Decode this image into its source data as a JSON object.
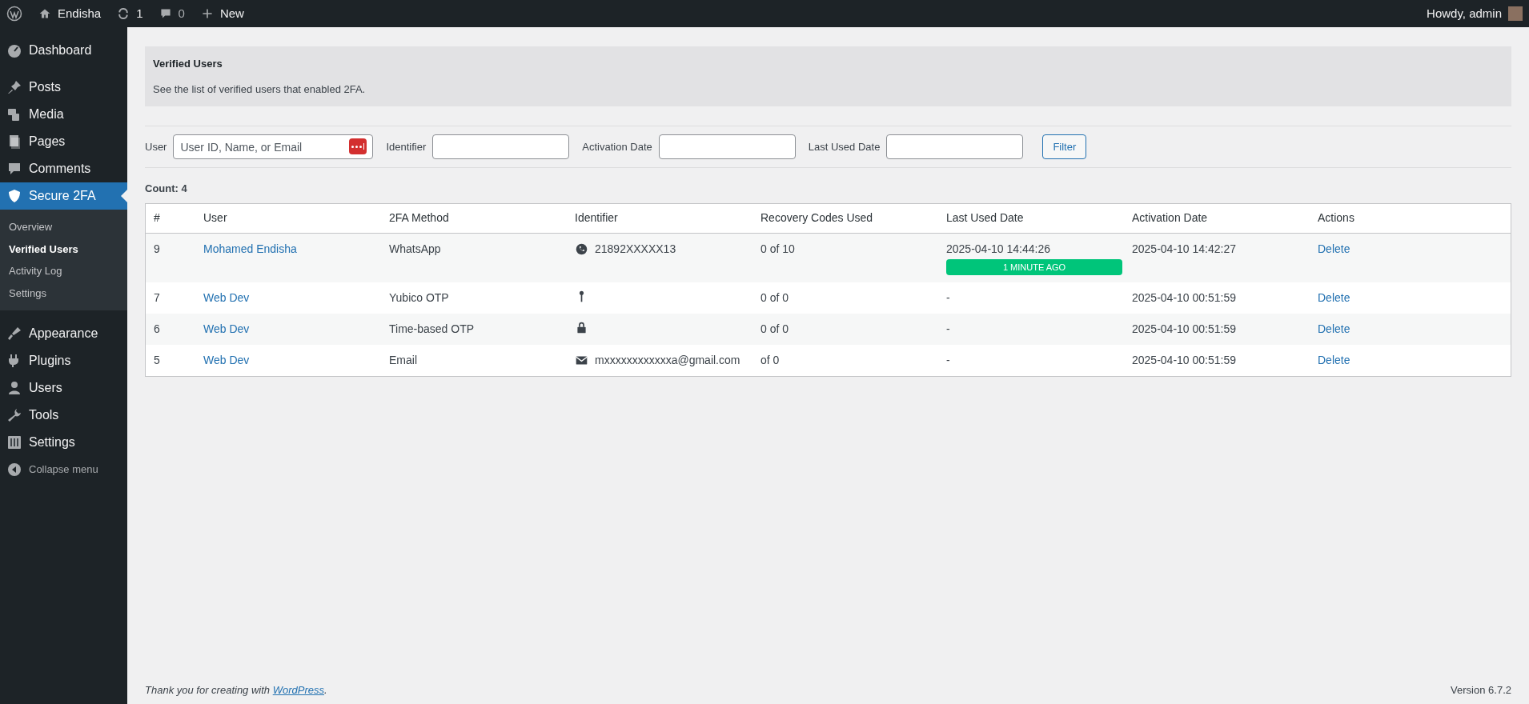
{
  "admin_bar": {
    "site": "Endisha",
    "updates": "1",
    "comments": "0",
    "new": "New",
    "greeting": "Howdy, admin"
  },
  "sidebar": {
    "items": [
      {
        "label": "Dashboard",
        "kind": "dashboard",
        "selected": false
      },
      {
        "label": "Posts",
        "kind": "pin",
        "selected": false
      },
      {
        "label": "Media",
        "kind": "media",
        "selected": false
      },
      {
        "label": "Pages",
        "kind": "pages",
        "selected": false
      },
      {
        "label": "Comments",
        "kind": "comment",
        "selected": false
      },
      {
        "label": "Secure 2FA",
        "kind": "shield",
        "selected": true,
        "children": [
          {
            "label": "Overview",
            "selected": false
          },
          {
            "label": "Verified Users",
            "selected": true
          },
          {
            "label": "Activity Log",
            "selected": false
          },
          {
            "label": "Settings",
            "selected": false
          }
        ]
      },
      {
        "label": "Appearance",
        "kind": "brush",
        "selected": false
      },
      {
        "label": "Plugins",
        "kind": "plug",
        "selected": false
      },
      {
        "label": "Users",
        "kind": "user",
        "selected": false
      },
      {
        "label": "Tools",
        "kind": "wrench",
        "selected": false
      },
      {
        "label": "Settings",
        "kind": "sliders",
        "selected": false
      }
    ],
    "collapse": "Collapse menu"
  },
  "notice": {
    "title": "Verified Users",
    "text": "See the list of verified users that enabled 2FA."
  },
  "filters": [
    {
      "label": "User",
      "placeholder": "User ID, Name, or Email",
      "kind": "user"
    },
    {
      "label": "Identifier",
      "kind": "plain"
    },
    {
      "label": "Activation Date",
      "kind": "plain"
    },
    {
      "label": "Last Used Date",
      "kind": "plain"
    }
  ],
  "filter_button": "Filter",
  "count": "Count: 4",
  "table": {
    "columns": [
      "#",
      "User",
      "2FA Method",
      "Identifier",
      "Recovery Codes Used",
      "Last Used Date",
      "Activation Date",
      "Actions"
    ],
    "rows": [
      {
        "id": "9",
        "user": "Mohamed Endisha",
        "method": "WhatsApp",
        "identifier": {
          "kind": "whatsapp",
          "text": "21892XXXXX13"
        },
        "recovery": "0 of 10",
        "last_used": "2025-04-10 14:44:26",
        "badge": "1 MINUTE AGO",
        "activation": "2025-04-10 14:42:27",
        "action": "Delete"
      },
      {
        "id": "7",
        "user": "Web Dev",
        "method": "Yubico OTP",
        "identifier": {
          "kind": "key"
        },
        "recovery": "0 of 0",
        "last_used": "-",
        "activation": "2025-04-10 00:51:59",
        "action": "Delete"
      },
      {
        "id": "6",
        "user": "Web Dev",
        "method": "Time-based OTP",
        "identifier": {
          "kind": "lock"
        },
        "recovery": "0 of 0",
        "last_used": "-",
        "activation": "2025-04-10 00:51:59",
        "action": "Delete"
      },
      {
        "id": "5",
        "user": "Web Dev",
        "method": "Email",
        "identifier": {
          "kind": "email",
          "text": "mxxxxxxxxxxxxa@gmail.com"
        },
        "recovery": "of 0",
        "last_used": "-",
        "activation": "2025-04-10 00:51:59",
        "action": "Delete"
      }
    ]
  },
  "footer": {
    "text": "Thank you for creating with ",
    "link": "WordPress",
    "after": ".",
    "version": "Version 6.7.2"
  }
}
